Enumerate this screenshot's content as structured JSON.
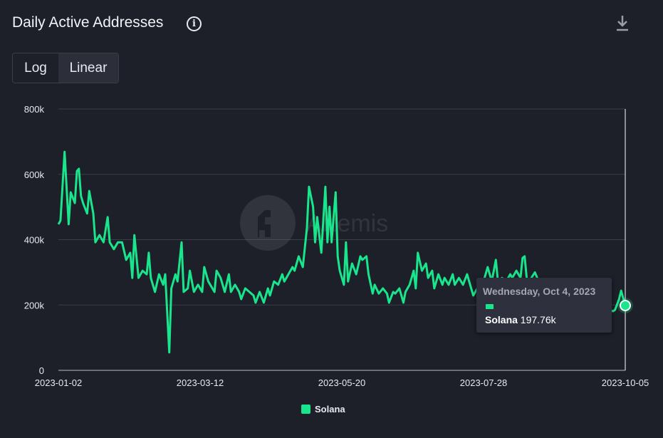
{
  "header": {
    "title": "Daily Active Addresses",
    "info_icon": "info-icon",
    "download_icon": "download-icon"
  },
  "scale_toggle": {
    "options": [
      "Log",
      "Linear"
    ],
    "selected": "Linear"
  },
  "watermark": "Artemis",
  "tooltip": {
    "date": "Wednesday, Oct 4, 2023",
    "series": "Solana",
    "value": "197.76k"
  },
  "chart_data": {
    "type": "line",
    "title": "Daily Active Addresses",
    "xlabel": "",
    "ylabel": "",
    "ylim": [
      0,
      800000
    ],
    "yticks": [
      "0",
      "200k",
      "400k",
      "600k",
      "800k"
    ],
    "xticks": [
      "2023-01-02",
      "2023-03-12",
      "2023-05-20",
      "2023-07-28",
      "2023-10-05"
    ],
    "x_start": "2023-01-02",
    "x_days_total": 276,
    "legend": "bottom-center",
    "grid": true,
    "series": [
      {
        "name": "Solana",
        "color": "#19e68c",
        "unit": "k",
        "points": [
          [
            0,
            447
          ],
          [
            1,
            458
          ],
          [
            3,
            669
          ],
          [
            5,
            447
          ],
          [
            6,
            545
          ],
          [
            8,
            512
          ],
          [
            9,
            610
          ],
          [
            10,
            617
          ],
          [
            11,
            534
          ],
          [
            12,
            512
          ],
          [
            14,
            480
          ],
          [
            15,
            549
          ],
          [
            17,
            480
          ],
          [
            18,
            392
          ],
          [
            20,
            414
          ],
          [
            22,
            392
          ],
          [
            24,
            469
          ],
          [
            25,
            392
          ],
          [
            27,
            371
          ],
          [
            29,
            392
          ],
          [
            31,
            392
          ],
          [
            33,
            338
          ],
          [
            35,
            360
          ],
          [
            36,
            283
          ],
          [
            37,
            414
          ],
          [
            39,
            283
          ],
          [
            41,
            305
          ],
          [
            43,
            294
          ],
          [
            44,
            360
          ],
          [
            45,
            283
          ],
          [
            47,
            240
          ],
          [
            49,
            294
          ],
          [
            51,
            262
          ],
          [
            52,
            294
          ],
          [
            54,
            55
          ],
          [
            55,
            251
          ],
          [
            57,
            294
          ],
          [
            58,
            272
          ],
          [
            60,
            392
          ],
          [
            61,
            240
          ],
          [
            63,
            251
          ],
          [
            64,
            305
          ],
          [
            66,
            240
          ],
          [
            68,
            262
          ],
          [
            70,
            240
          ],
          [
            71,
            316
          ],
          [
            73,
            272
          ],
          [
            76,
            240
          ],
          [
            77,
            305
          ],
          [
            79,
            283
          ],
          [
            81,
            240
          ],
          [
            83,
            294
          ],
          [
            84,
            240
          ],
          [
            86,
            262
          ],
          [
            88,
            240
          ],
          [
            89,
            218
          ],
          [
            91,
            251
          ],
          [
            93,
            240
          ],
          [
            95,
            229
          ],
          [
            96,
            207
          ],
          [
            98,
            240
          ],
          [
            100,
            207
          ],
          [
            102,
            251
          ],
          [
            103,
            229
          ],
          [
            105,
            272
          ],
          [
            107,
            262
          ],
          [
            109,
            294
          ],
          [
            110,
            272
          ],
          [
            112,
            294
          ],
          [
            114,
            316
          ],
          [
            115,
            305
          ],
          [
            117,
            349
          ],
          [
            119,
            316
          ],
          [
            121,
            436
          ],
          [
            122,
            562
          ],
          [
            124,
            501
          ],
          [
            125,
            392
          ],
          [
            126,
            469
          ],
          [
            128,
            360
          ],
          [
            130,
            562
          ],
          [
            131,
            392
          ],
          [
            132,
            501
          ],
          [
            133,
            392
          ],
          [
            135,
            545
          ],
          [
            136,
            349
          ],
          [
            137,
            305
          ],
          [
            139,
            262
          ],
          [
            140,
            392
          ],
          [
            141,
            272
          ],
          [
            143,
            327
          ],
          [
            145,
            294
          ],
          [
            147,
            349
          ],
          [
            148,
            338
          ],
          [
            150,
            349
          ],
          [
            151,
            294
          ],
          [
            153,
            235
          ],
          [
            154,
            262
          ],
          [
            156,
            235
          ],
          [
            158,
            251
          ],
          [
            160,
            235
          ],
          [
            161,
            207
          ],
          [
            163,
            240
          ],
          [
            164,
            235
          ],
          [
            166,
            251
          ],
          [
            168,
            207
          ],
          [
            169,
            240
          ],
          [
            171,
            262
          ],
          [
            173,
            305
          ],
          [
            174,
            251
          ],
          [
            175,
            360
          ],
          [
            177,
            305
          ],
          [
            179,
            327
          ],
          [
            180,
            283
          ],
          [
            182,
            305
          ],
          [
            183,
            251
          ],
          [
            185,
            294
          ],
          [
            187,
            262
          ],
          [
            188,
            283
          ],
          [
            190,
            262
          ],
          [
            192,
            294
          ],
          [
            193,
            262
          ],
          [
            195,
            283
          ],
          [
            197,
            262
          ],
          [
            199,
            294
          ],
          [
            200,
            272
          ],
          [
            202,
            229
          ],
          [
            204,
            251
          ],
          [
            206,
            262
          ],
          [
            207,
            272
          ],
          [
            209,
            316
          ],
          [
            211,
            272
          ],
          [
            213,
            338
          ],
          [
            214,
            272
          ],
          [
            216,
            283
          ],
          [
            218,
            272
          ],
          [
            220,
            294
          ],
          [
            221,
            283
          ],
          [
            223,
            305
          ],
          [
            225,
            283
          ],
          [
            226,
            344
          ],
          [
            227,
            349
          ],
          [
            229,
            218
          ],
          [
            230,
            280
          ],
          [
            232,
            300
          ],
          [
            234,
            270
          ],
          [
            236,
            240
          ],
          [
            242,
            230
          ],
          [
            249,
            220
          ],
          [
            256,
            210
          ],
          [
            263,
            200
          ],
          [
            270,
            181
          ],
          [
            271,
            185
          ],
          [
            273,
            218
          ],
          [
            274,
            244
          ],
          [
            276,
            198
          ]
        ]
      }
    ]
  }
}
